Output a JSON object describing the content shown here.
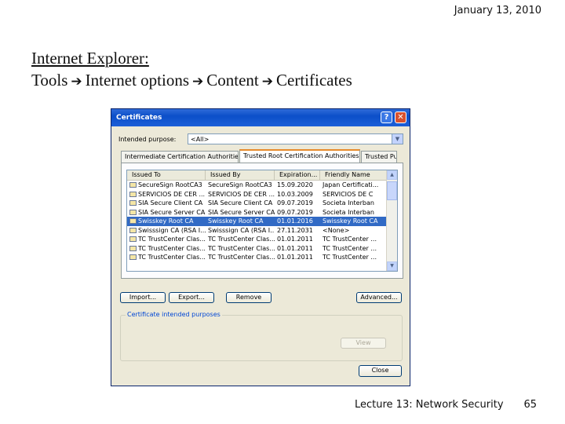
{
  "slide": {
    "date": "January 13, 2010",
    "heading_line1": "Internet Explorer:",
    "path": [
      "Tools",
      "Internet options",
      "Content",
      "Certificates"
    ],
    "footer": "Lecture 13: Network Security",
    "page_number": "65"
  },
  "dialog": {
    "title": "Certificates",
    "help_label": "?",
    "close_label": "✕",
    "intended_purpose_label": "Intended purpose:",
    "intended_purpose_value": "<All>",
    "tabs": [
      "Intermediate Certification Authorities",
      "Trusted Root Certification Authorities",
      "Trusted Pub"
    ],
    "columns": [
      "Issued To",
      "Issued By",
      "Expiration...",
      "Friendly Name"
    ],
    "rows": [
      {
        "to": "SecureSign RootCA3",
        "by": "SecureSign RootCA3",
        "exp": "15.09.2020",
        "name": "Japan Certificati..."
      },
      {
        "to": "SERVICIOS DE CER ...",
        "by": "SERVICIOS DE CER ...",
        "exp": "10.03.2009",
        "name": "SERVICIOS DE C"
      },
      {
        "to": "SIA Secure Client CA",
        "by": "SIA Secure Client CA",
        "exp": "09.07.2019",
        "name": "Societa Interban"
      },
      {
        "to": "SIA Secure Server CA",
        "by": "SIA Secure Server CA",
        "exp": "09.07.2019",
        "name": "Societa Interban"
      },
      {
        "to": "Swisskey Root CA",
        "by": "Swisskey Root CA",
        "exp": "01.01.2016",
        "name": "Swisskey Root CA"
      },
      {
        "to": "Swisssign CA (RSA I...",
        "by": "Swisssign CA (RSA I...",
        "exp": "27.11.2031",
        "name": "<None>"
      },
      {
        "to": "TC TrustCenter Clas...",
        "by": "TC TrustCenter Clas...",
        "exp": "01.01.2011",
        "name": "TC TrustCenter ..."
      },
      {
        "to": "TC TrustCenter Clas...",
        "by": "TC TrustCenter Clas...",
        "exp": "01.01.2011",
        "name": "TC TrustCenter ..."
      },
      {
        "to": "TC TrustCenter Clas...",
        "by": "TC TrustCenter Clas...",
        "exp": "01.01.2011",
        "name": "TC TrustCenter ..."
      }
    ],
    "selected_row": "Swisskey Root CA",
    "buttons": {
      "import": "Import...",
      "export": "Export...",
      "remove": "Remove",
      "advanced": "Advanced...",
      "view": "View",
      "close": "Close"
    },
    "group_label": "Certificate intended purposes",
    "colors": {
      "titlebar": "#0c4fc9",
      "selection": "#316ac5",
      "dialog_bg": "#ece9d8"
    }
  }
}
